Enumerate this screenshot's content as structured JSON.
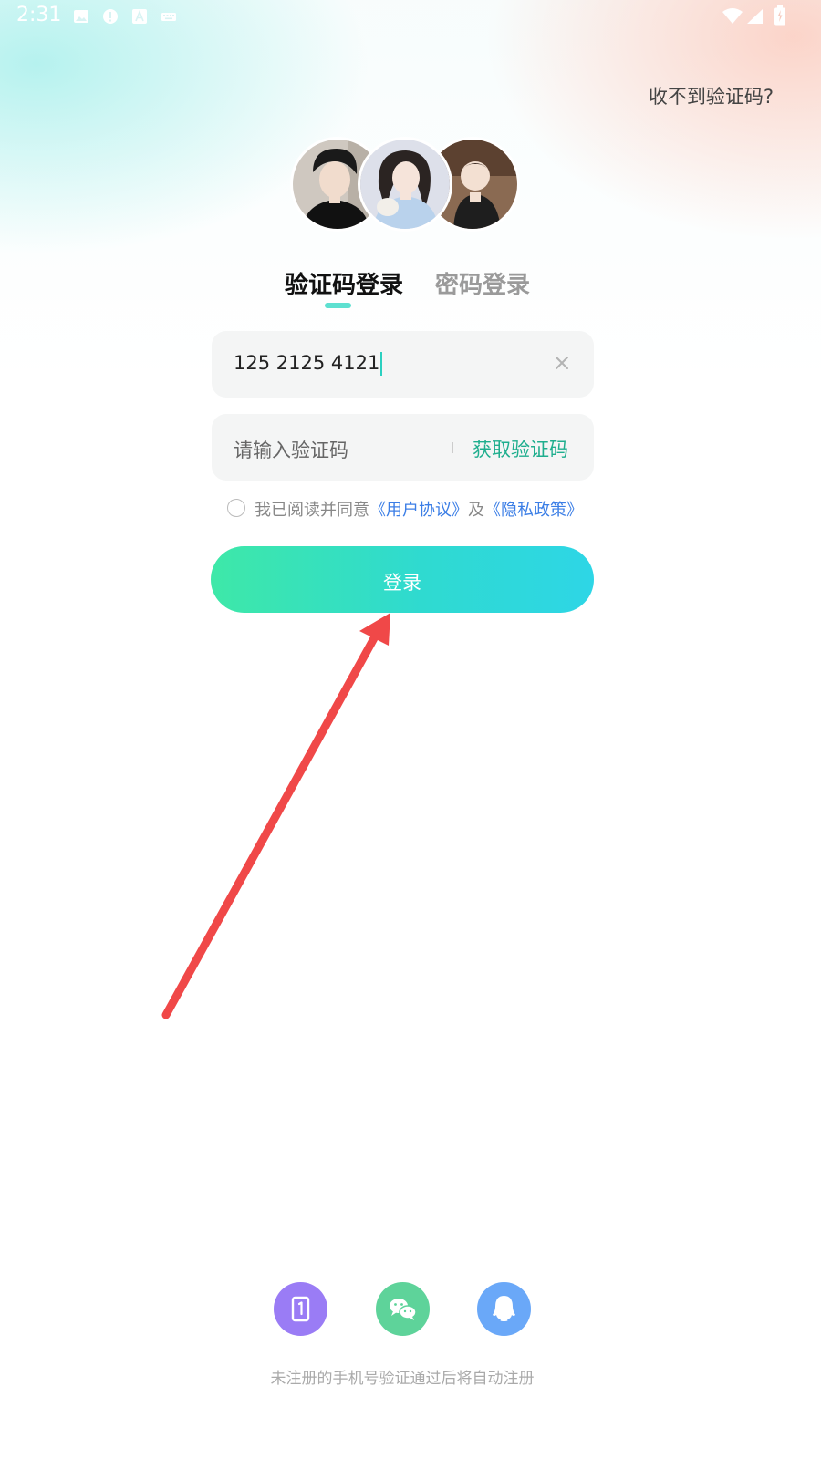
{
  "status_bar": {
    "time": "2:31",
    "icons": [
      "image-icon",
      "alert-icon",
      "font-icon",
      "keyboard-icon",
      "wifi-icon",
      "signal-icon",
      "battery-icon"
    ]
  },
  "header": {
    "help_link": "收不到验证码?"
  },
  "tabs": [
    {
      "label": "验证码登录",
      "active": true
    },
    {
      "label": "密码登录",
      "active": false
    }
  ],
  "form": {
    "phone_value": "125 2125 4121",
    "code_placeholder": "请输入验证码",
    "get_code_label": "获取验证码",
    "agreement": {
      "prefix": "我已阅读并同意",
      "user_agreement": "《用户协议》",
      "conjunction": "及",
      "privacy_policy": "《隐私政策》",
      "checked": false
    },
    "login_label": "登录"
  },
  "social_login": [
    {
      "icon": "phone-number-icon",
      "color": "#9a7cf5"
    },
    {
      "icon": "wechat-icon",
      "color": "#5ed39a"
    },
    {
      "icon": "qq-icon",
      "color": "#6aa8f8"
    }
  ],
  "footer_note": "未注册的手机号验证通过后将自动注册",
  "colors": {
    "accent": "#2fdad0",
    "link": "#3b7ee6",
    "annotation_arrow": "#f04848"
  }
}
